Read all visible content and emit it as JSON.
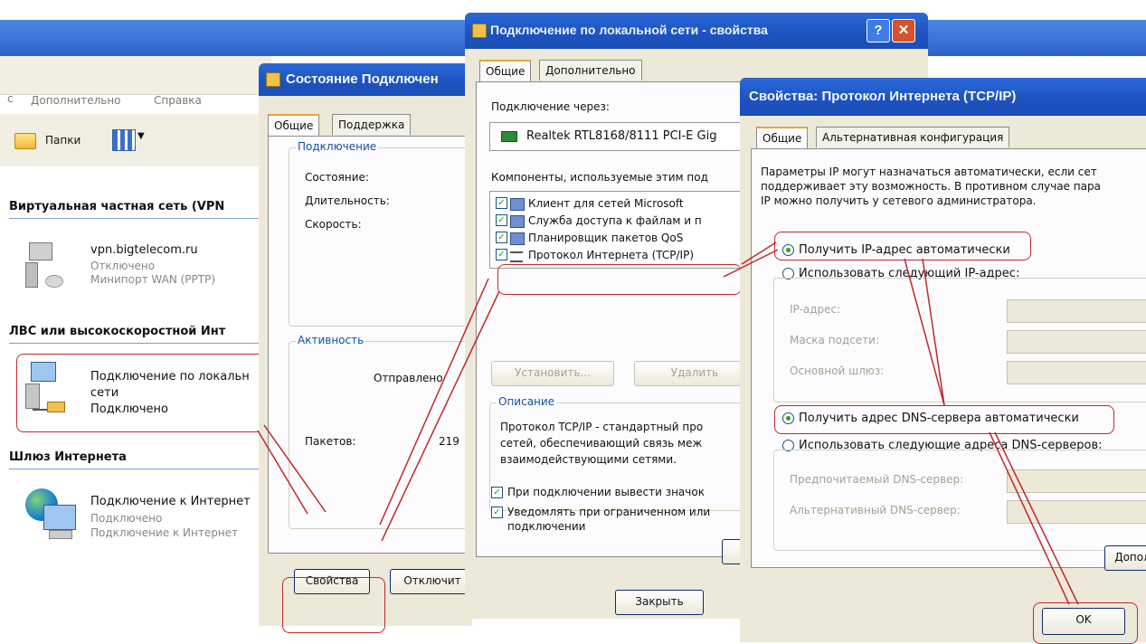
{
  "explorer": {
    "menu": {
      "extra": "Дополнительно",
      "help": "Справка",
      "prefix": "с"
    },
    "toolbar": {
      "folders": "Папки"
    },
    "groups": [
      {
        "title": "Виртуальная частная сеть (VPN",
        "items": [
          {
            "name": "vpn.bigtelecom.ru",
            "status": "Отключено",
            "device": "Минипорт WAN (PPTP)"
          }
        ]
      },
      {
        "title": "ЛВС или высокоскоростной Инт",
        "items": [
          {
            "name": "Подключение по локальн",
            "name2": "сети",
            "status": "Подключено"
          }
        ]
      },
      {
        "title": "Шлюз Интернета",
        "items": [
          {
            "name": "Подключение к Интернет",
            "status": "Подключено",
            "device": "Подключение к Интернет"
          }
        ]
      }
    ]
  },
  "status_dialog": {
    "title": "Состояние Подключен",
    "tabs": [
      "Общие",
      "Поддержка"
    ],
    "connection_group": "Подключение",
    "fields": [
      "Состояние:",
      "Длительность:",
      "Скорость:"
    ],
    "activity_group": "Активность",
    "sent": "Отправлено",
    "packets_label": "Пакетов:",
    "packets_value": "219",
    "properties_button": "Свойства",
    "disconnect_button": "Отключит"
  },
  "lan_dialog": {
    "title": "Подключение по локальной сети - свойства",
    "tabs": [
      "Общие",
      "Дополнительно"
    ],
    "connect_via": "Подключение через:",
    "adapter": "Realtek RTL8168/8111 PCI-E Gig",
    "components_label": "Компоненты, используемые этим под",
    "components": [
      "Клиент для сетей Microsoft",
      "Служба доступа к файлам и п",
      "Планировщик пакетов QoS",
      "Протокол Интернета (TCP/IP)"
    ],
    "install": "Установить...",
    "remove": "Удалить",
    "description_group": "Описание",
    "description": [
      "Протокол TCP/IP - стандартный про",
      "сетей, обеспечивающий связь меж",
      "взаимодействующими сетями."
    ],
    "show_icon": "При подключении вывести значок",
    "notify": [
      "Уведомлять при ограниченном или",
      "подключении"
    ],
    "close": "Закрыть",
    "help_glyph": "?",
    "close_glyph": "✕"
  },
  "tcpip_dialog": {
    "title": "Свойства: Протокол Интернета (TCP/IP)",
    "tabs": [
      "Общие",
      "Альтернативная конфигурация"
    ],
    "intro": [
      "Параметры IP могут назначаться автоматически, если сет",
      "поддерживает эту возможность. В противном случае пара",
      "IP можно получить у сетевого администратора."
    ],
    "auto_ip": "Получить IP-адрес автоматически",
    "manual_ip": "Использовать следующий IP-адрес:",
    "ip_fields": [
      "IP-адрес:",
      "Маска подсети:",
      "Основной шлюз:"
    ],
    "auto_dns": "Получить адрес DNS-сервера автоматически",
    "manual_dns": "Использовать следующие адреса DNS-серверов:",
    "dns_fields": [
      "Предпочитаемый DNS-сервер:",
      "Альтернативный DNS-сервер:"
    ],
    "advanced": "Допол",
    "ok": "OK"
  }
}
